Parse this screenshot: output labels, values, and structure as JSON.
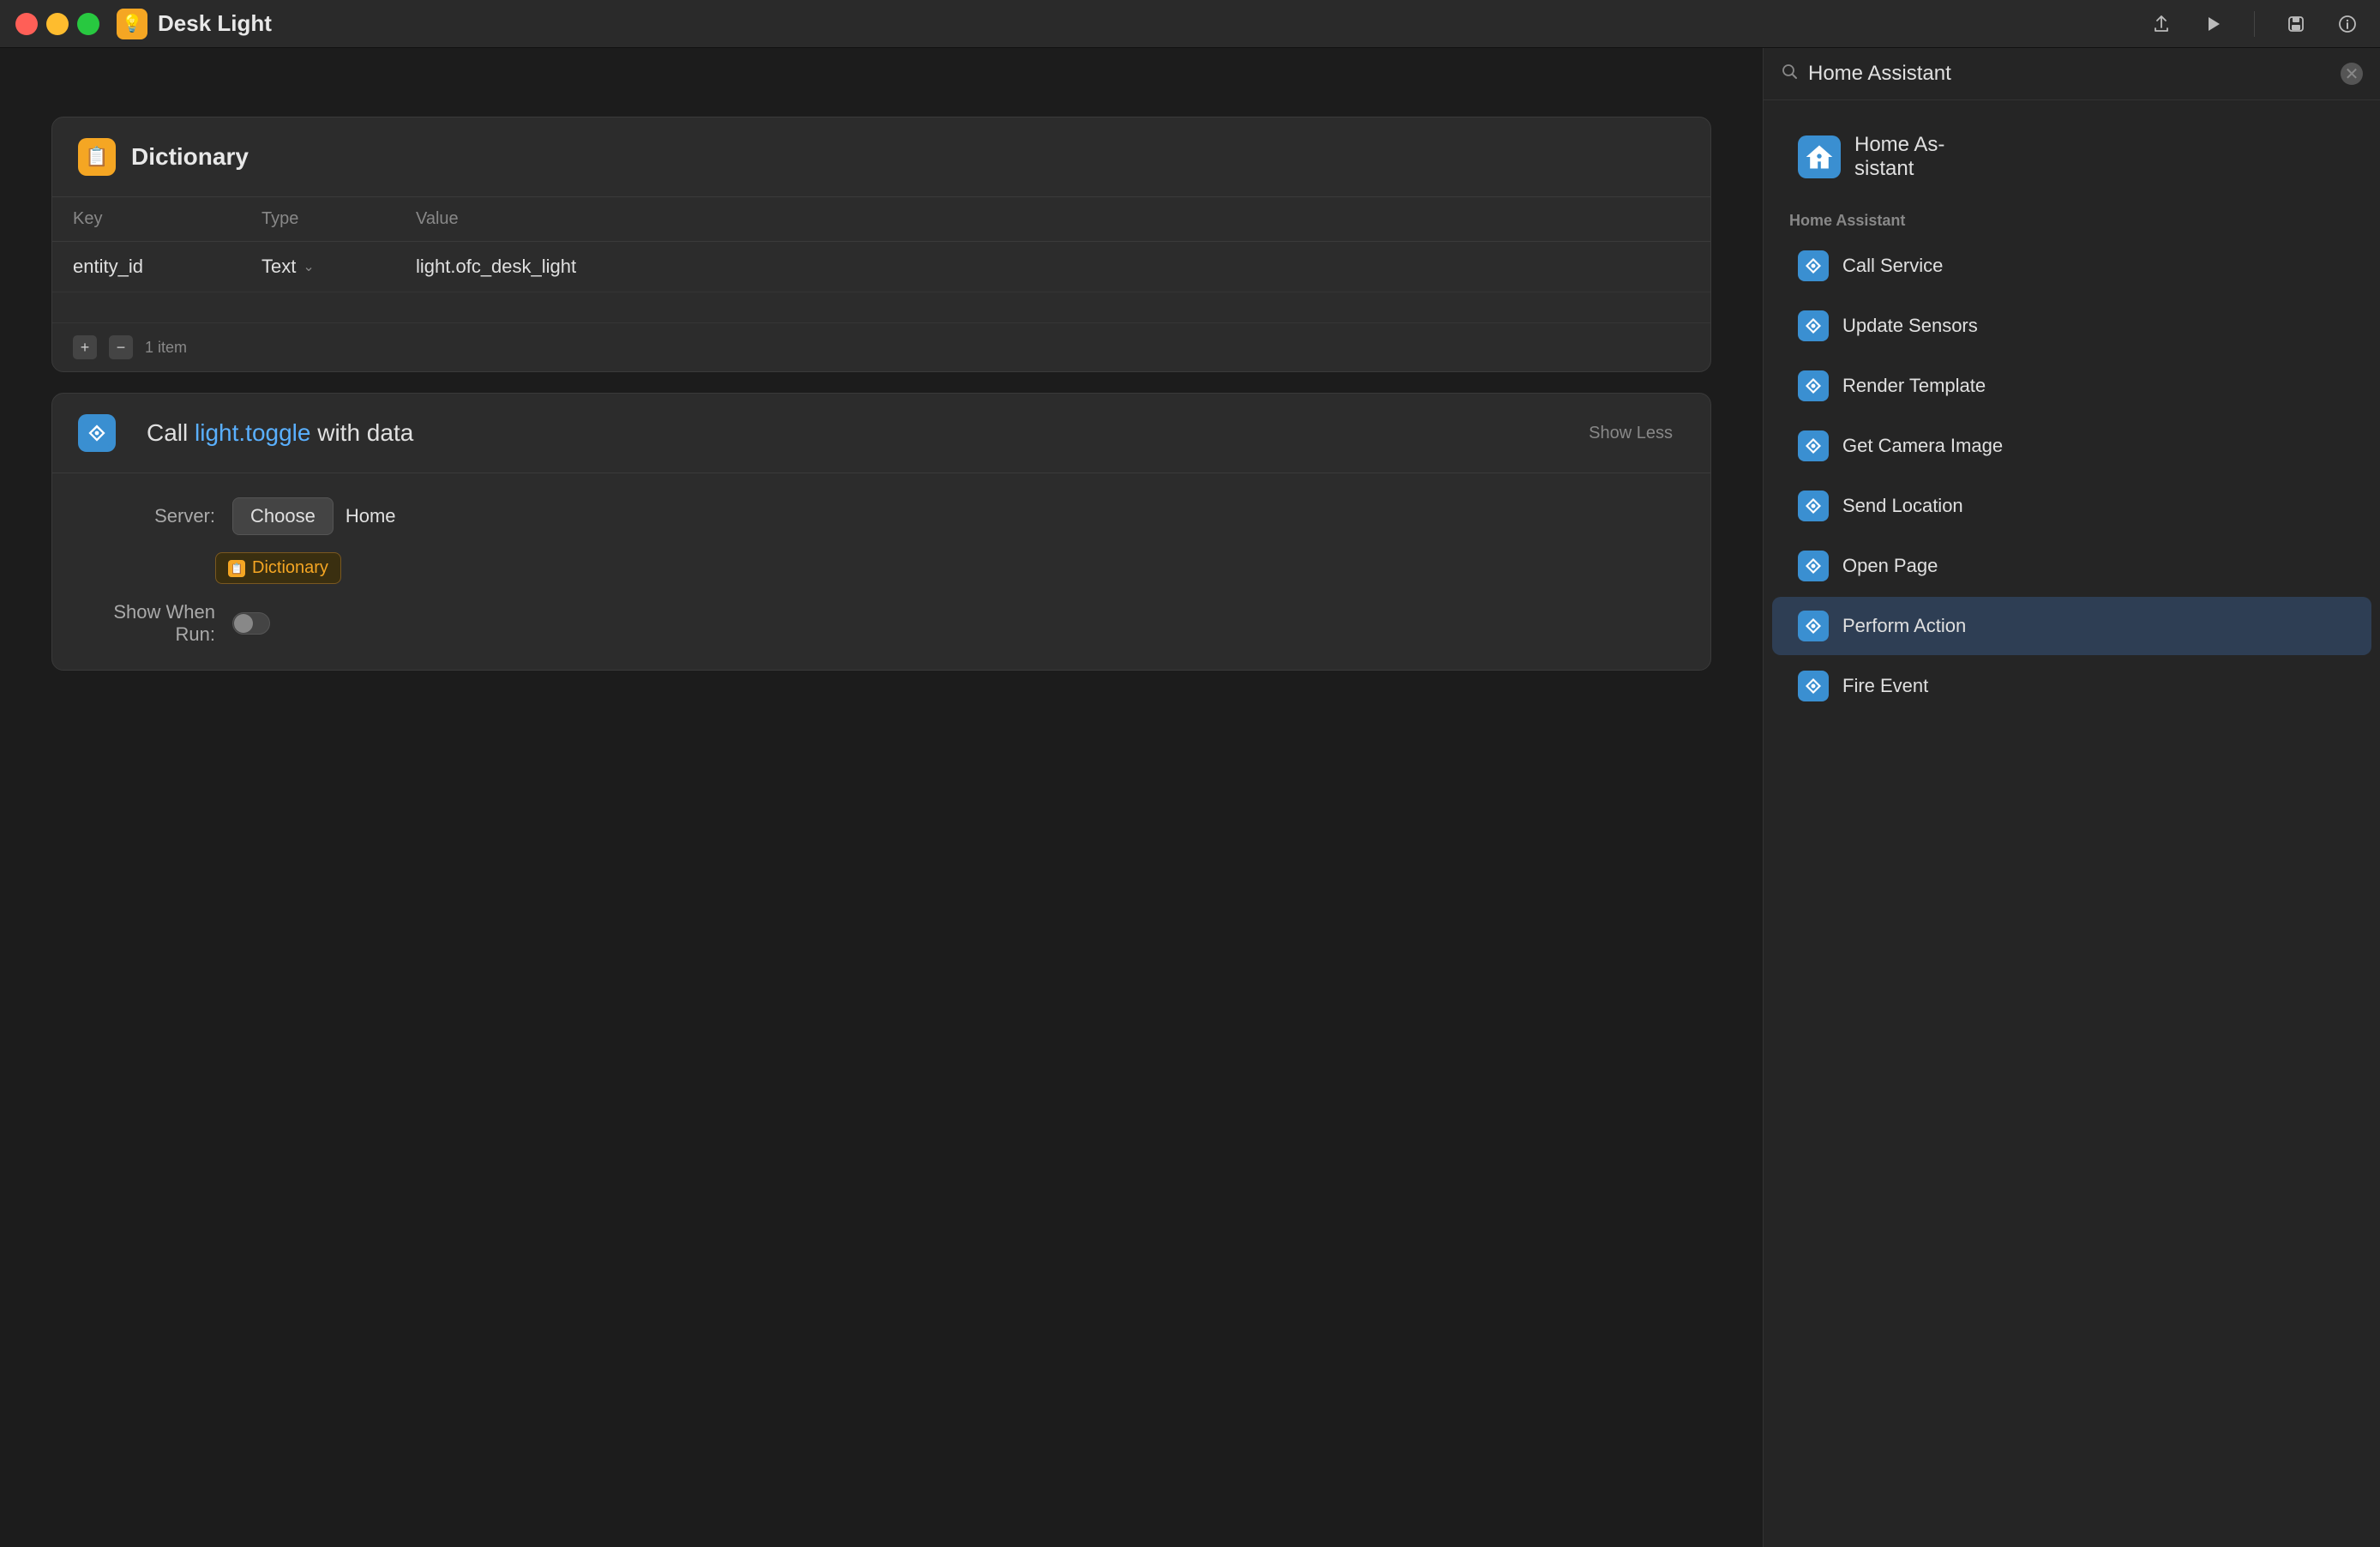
{
  "titlebar": {
    "title": "Desk Light",
    "app_icon": "💡",
    "actions": {
      "share": "⬆",
      "play": "▶",
      "save": "⬇",
      "info": "ℹ"
    }
  },
  "dictionary_card": {
    "icon": "📋",
    "title": "Dictionary",
    "columns": {
      "key": "Key",
      "type": "Type",
      "value": "Value"
    },
    "rows": [
      {
        "key": "entity_id",
        "type": "Text",
        "value": "light.ofc_desk_light"
      }
    ],
    "footer": {
      "item_count": "1 item",
      "add_label": "+",
      "remove_label": "−"
    }
  },
  "call_card": {
    "icon_color": "#3a8fd1",
    "call_label": "Call",
    "method": "light.toggle",
    "with_data": "with data",
    "show_less": "Show Less",
    "server_label": "Server:",
    "choose_label": "Choose",
    "server_value": "Home",
    "dictionary_badge": "Dictionary",
    "show_when_run_label": "Show When Run:"
  },
  "sidebar": {
    "search_placeholder": "Home Assistant",
    "search_value": "Home Assistant",
    "app_title": "Home As-\nsistant",
    "section_title": "Home Assistant",
    "menu_items": [
      {
        "id": "call-service",
        "label": "Call Service",
        "active": false
      },
      {
        "id": "update-sensors",
        "label": "Update Sensors",
        "active": false
      },
      {
        "id": "render-template",
        "label": "Render Template",
        "active": false
      },
      {
        "id": "get-camera-image",
        "label": "Get Camera Image",
        "active": false
      },
      {
        "id": "send-location",
        "label": "Send Location",
        "active": false
      },
      {
        "id": "open-page",
        "label": "Open Page",
        "active": false
      },
      {
        "id": "perform-action",
        "label": "Perform Action",
        "active": true
      },
      {
        "id": "fire-event",
        "label": "Fire Event",
        "active": false
      }
    ]
  },
  "colors": {
    "accent_blue": "#5ab0ff",
    "accent_orange": "#f5a623",
    "ha_blue": "#3a8fd1"
  }
}
